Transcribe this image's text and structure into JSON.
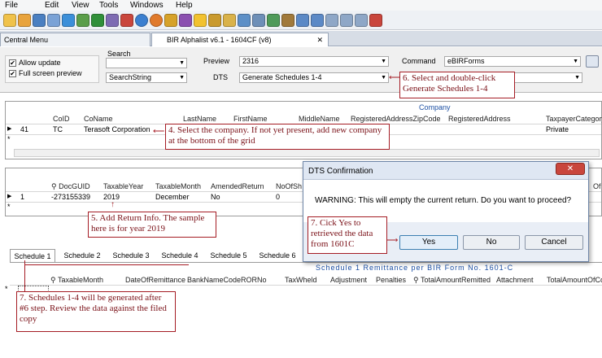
{
  "menu": [
    "File",
    "Edit",
    "View",
    "Tools",
    "Windows",
    "Help"
  ],
  "toolbar_icons": [
    "new-icon",
    "open-icon",
    "save-icon",
    "print-icon",
    "up-icon",
    "export-icon",
    "refresh-icon",
    "undo-icon",
    "search-icon",
    "help-icon",
    "about-icon",
    "tax-icon",
    "cm-icon",
    "star-icon",
    "tag-icon",
    "calendar-icon",
    "sheet-icon",
    "user-icon",
    "tree-icon",
    "pin-icon",
    "zoom-in-icon",
    "zoom-out-icon",
    "window-icon",
    "tile-icon",
    "cascade-icon",
    "close-icon"
  ],
  "tabs": {
    "central": "Central Menu",
    "doc": "BIR Alphalist v6.1 - 1604CF (v8)",
    "doc_close": "✕"
  },
  "params": {
    "allow_update": "Allow update",
    "full_screen": "Full screen preview",
    "search_label": "Search",
    "search_value": "",
    "search_string": "SearchString",
    "preview_label": "Preview",
    "preview_value": "2316",
    "dts_label": "DTS",
    "dts_value": "Generate Schedules 1-4",
    "command_label": "Command",
    "command_value": "eBIRForms"
  },
  "company_grid": {
    "title": "Company",
    "columns": [
      "CoID",
      "CoName",
      "LastName",
      "FirstName",
      "MiddleName",
      "RegisteredAddressZipCode",
      "RegisteredAddress",
      "TaxpayerCategory"
    ],
    "row": {
      "index": "41",
      "coid": "TC",
      "coname": "Terasoft Corporation",
      "category": "Private"
    }
  },
  "return_grid": {
    "columns": [
      "DocGUID",
      "TaxableYear",
      "TaxableMonth",
      "AmendedReturn",
      "NoOfSh"
    ],
    "row": {
      "index": "1",
      "docguid": "-273155339",
      "year": "2019",
      "month": "December",
      "amended": "No",
      "sheets": "0"
    },
    "right_fragment": "Of"
  },
  "schedule_tabs": [
    "Schedule 1",
    "Schedule 2",
    "Schedule 3",
    "Schedule 4",
    "Schedule 5",
    "Schedule 6"
  ],
  "schedule_grid": {
    "subtitle": "Schedule 1 Remittance per BIR Form No. 1601-C",
    "columns": [
      "TaxableMonth",
      "DateOfRemittance",
      "BankNameCodeRORNo",
      "TaxWheld",
      "Adjustment",
      "Penalties",
      "TotalAmountRemitted",
      "Attachment",
      "TotalAmountOfCo"
    ]
  },
  "dialog": {
    "title": "DTS Confirmation",
    "message": "WARNING: This will empty the current return. Do you want to proceed?",
    "yes": "Yes",
    "no": "No",
    "cancel": "Cancel"
  },
  "annotations": {
    "a4": "4. Select the company. If not yet present, add new company  at the bottom of the grid",
    "a5": "5. Add Return Info. The sample here is for year 2019",
    "a6": "6. Select and double-click Generate Schedules 1-4",
    "a7": "7. Cick Yes to retrieved the data from 1601C",
    "a7b": "7. Schedules 1-4 will be generated after #6 step. Review the data against the filed copy"
  },
  "colors": {
    "annotation": "#a51c24",
    "dialog_bg": "#e9eef6",
    "toolbar_bg": "#eef1f5"
  }
}
